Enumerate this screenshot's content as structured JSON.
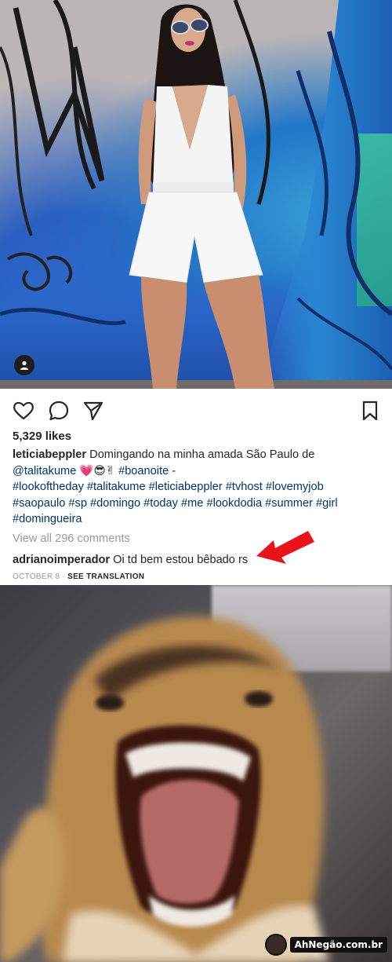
{
  "post": {
    "likes": "5,329 likes",
    "caption": {
      "username": "leticiabeppler",
      "text_1": "Domingando na minha amada São Paulo de",
      "mention": "@talitakume",
      "emojis": "💗😎✌",
      "tag_1": "#boanoite",
      "dash": " -",
      "tags_line_1": "#lookoftheday #talitakume #leticiabeppler #tvhost #lovemyjob",
      "tags_line_2": "#saopaulo #sp #domingo #today #me #lookdodia #summer #girl",
      "tags_line_3": "#domingueira"
    },
    "view_all_comments": "View all 296 comments",
    "comment": {
      "username": "adrianoimperador",
      "text": "Oi td bem estou bêbado rs"
    },
    "date": "OCTOBER 8",
    "separator": " · ",
    "see_translation": "SEE TRANSLATION"
  },
  "icons": {
    "like": "heart-icon",
    "comment": "comment-icon",
    "share": "send-icon",
    "save": "bookmark-icon",
    "tagged_user": "user-tag-icon",
    "annotation": "red-arrow-icon"
  },
  "watermark": {
    "text": "AhNegão.com.br"
  },
  "colors": {
    "text": "#262626",
    "muted": "#999999",
    "hashtag": "#003569",
    "arrow": "#e8141a"
  }
}
